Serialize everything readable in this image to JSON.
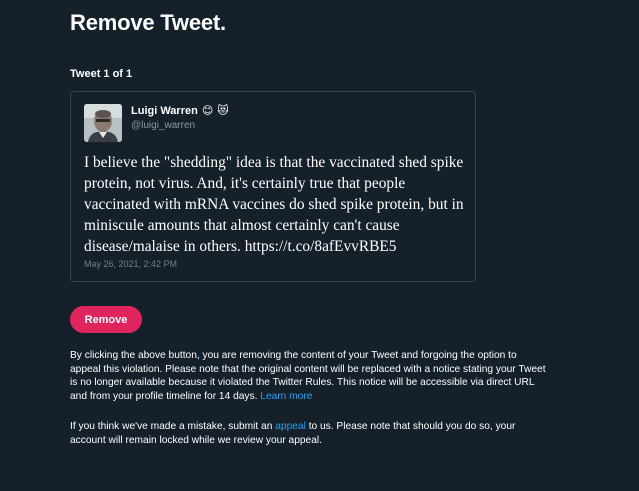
{
  "page": {
    "title": "Remove Tweet."
  },
  "tweet_counter": "Tweet 1 of 1",
  "tweet": {
    "author_name": "Luigi Warren",
    "author_emojis": [
      "😊",
      "😻"
    ],
    "handle": "@luigi_warren",
    "text": "I believe the \"shedding\" idea is that the vaccinated shed spike protein, not virus. And, it's certainly true that people vaccinated with mRNA vaccines do shed spike protein, but in miniscule amounts that almost certainly can't cause disease/malaise in others. https://t.co/8afEvvRBE5",
    "date": "May 26, 2021, 2:42 PM"
  },
  "remove_button": {
    "label": "Remove",
    "color": "#e0245e"
  },
  "notice": {
    "paragraph1_text": "By clicking the above button, you are removing the content of your Tweet and forgoing the option to appeal this violation. Please note that the original content will be replaced with a notice stating your Tweet is no longer available because it violated the Twitter Rules. This notice will be accessible via direct URL and from your profile timeline for 14 days.",
    "learn_more_label": "Learn more",
    "paragraph2_before": "If you think we've made a mistake, submit an",
    "appeal_label": "appeal",
    "paragraph2_after": "to us. Please note that should you do so, your account will remain locked while we review your appeal."
  },
  "colors": {
    "background": "#15202b",
    "link": "#1da1f2",
    "border": "#38444d",
    "muted_text": "#8899a6"
  }
}
